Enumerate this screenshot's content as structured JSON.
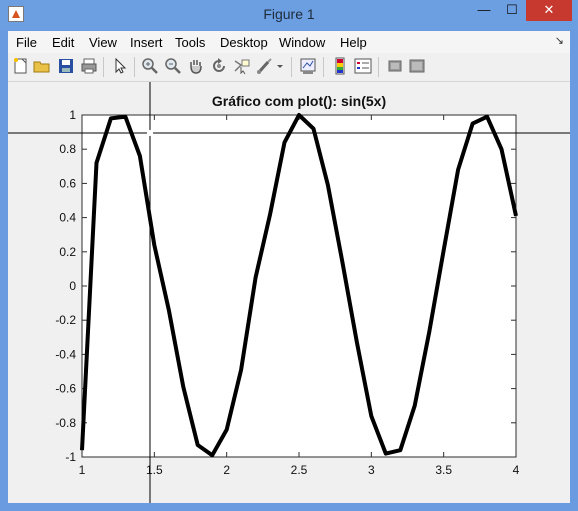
{
  "window": {
    "title": "Figure 1",
    "min_glyph": "—",
    "max_glyph": "☐",
    "close_glyph": "✕"
  },
  "menu": [
    "File",
    "Edit",
    "View",
    "Insert",
    "Tools",
    "Desktop",
    "Window",
    "Help"
  ],
  "toolbar": [
    "new-figure",
    "open-file",
    "save",
    "print",
    "edit-plot",
    "zoom-in",
    "zoom-out",
    "pan",
    "rotate-3d",
    "data-cursor",
    "brush",
    "link-plot",
    "colorbar",
    "legend",
    "hide-plot-tools",
    "show-plot-tools"
  ],
  "chart_data": {
    "type": "line",
    "title": "Gráfico com plot(): sin(5x)",
    "xlim": [
      1,
      4
    ],
    "ylim": [
      -1,
      1
    ],
    "xticks": [
      "1",
      "1.5",
      "2",
      "2.5",
      "3",
      "3.5",
      "4"
    ],
    "yticks": [
      "1",
      "0.8",
      "0.6",
      "0.4",
      "0.2",
      "0",
      "-0.2",
      "-0.4",
      "-0.6",
      "-0.8",
      "-1"
    ],
    "series": [
      {
        "color": "#000000",
        "x": [
          1,
          1.1,
          1.2,
          1.3,
          1.4,
          1.5,
          1.6,
          1.7,
          1.8,
          1.9,
          2,
          2.1,
          2.2,
          2.3,
          2.4,
          2.5,
          2.6,
          2.7,
          2.8,
          2.9,
          3,
          3.1,
          3.2,
          3.3,
          3.4,
          3.5,
          3.6,
          3.7,
          3.8,
          3.9,
          4
        ],
        "y": [
          -0.96,
          0.72,
          0.98,
          0.99,
          0.76,
          0.24,
          -0.14,
          -0.59,
          -0.93,
          -0.99,
          -0.84,
          -0.49,
          0.05,
          0.42,
          0.84,
          1.0,
          0.92,
          0.59,
          0.14,
          -0.33,
          -0.76,
          -0.98,
          -0.96,
          -0.7,
          -0.27,
          0.21,
          0.68,
          0.95,
          0.99,
          0.8,
          0.41
        ]
      }
    ],
    "crosshair": {
      "x": 1.47,
      "y": 0.895
    }
  }
}
